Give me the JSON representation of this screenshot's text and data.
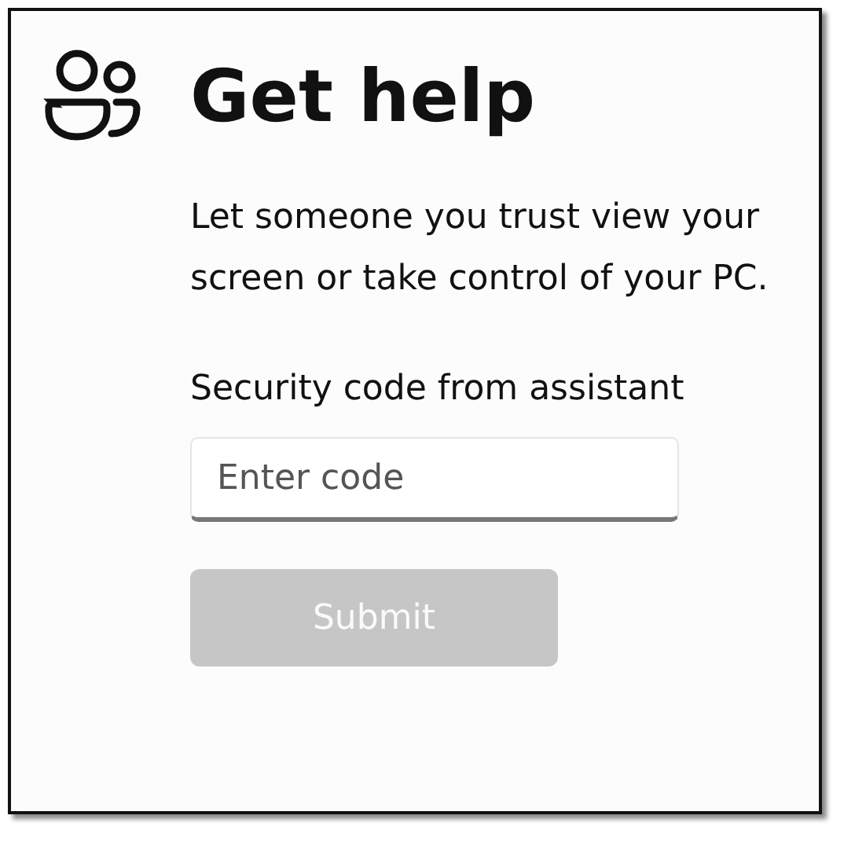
{
  "header": {
    "title": "Get help"
  },
  "description": "Let someone you trust view your screen or take control of your PC.",
  "code_field": {
    "label": "Security code from assistant",
    "placeholder": "Enter code"
  },
  "submit_button": {
    "label": "Submit",
    "disabled": true
  }
}
